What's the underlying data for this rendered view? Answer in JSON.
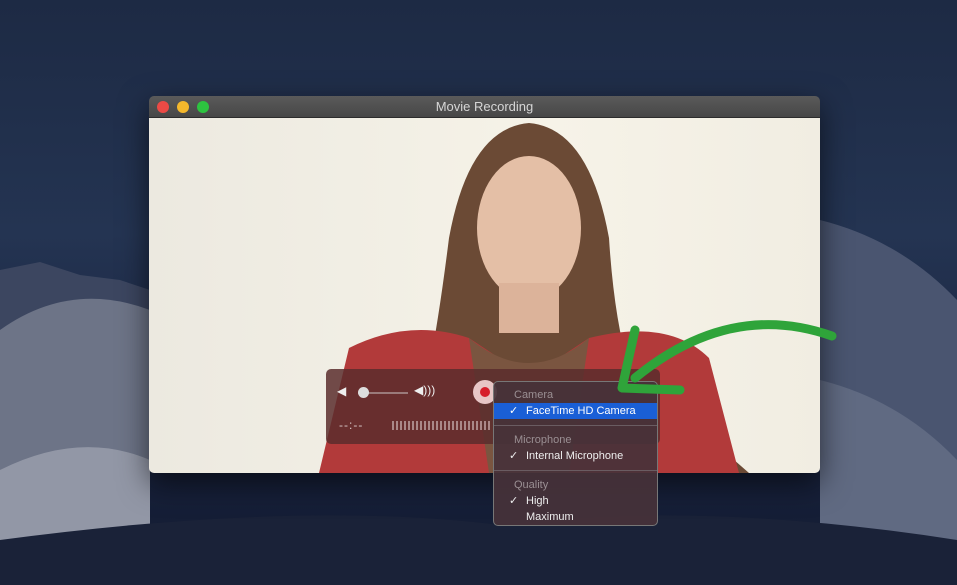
{
  "window": {
    "title": "Movie Recording"
  },
  "controls": {
    "time": "--:--",
    "volume_level": 0.1
  },
  "menu": {
    "sections": [
      {
        "header": "Camera",
        "items": [
          {
            "label": "FaceTime HD Camera",
            "checked": true,
            "highlighted": true
          }
        ]
      },
      {
        "header": "Microphone",
        "items": [
          {
            "label": "Internal Microphone",
            "checked": true
          }
        ]
      },
      {
        "header": "Quality",
        "items": [
          {
            "label": "High",
            "checked": true
          },
          {
            "label": "Maximum",
            "checked": false
          }
        ]
      }
    ],
    "check": "✓"
  },
  "colors": {
    "close": "#ec4a45",
    "minimize": "#f5b82c",
    "zoom": "#2dc340",
    "record": "#d61f2c",
    "highlight": "#1a5fd6",
    "arrow": "#2fa43a"
  }
}
